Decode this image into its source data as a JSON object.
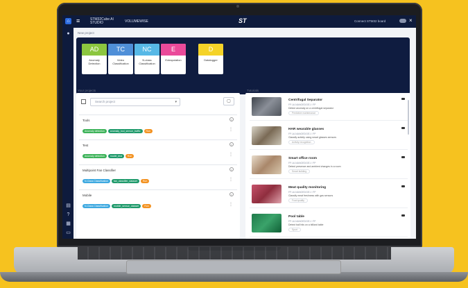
{
  "brand": {
    "line1": "STM32Cube AI",
    "line2": "STUDIO",
    "partner": "VOLUMEWISE",
    "logo": "ST",
    "right_text": "Connect STM32 board"
  },
  "sidebar": {
    "icons": [
      "home-icon",
      "user-icon",
      "file-icon",
      "help-icon",
      "doc-icon",
      "folder-icon"
    ]
  },
  "new_project": {
    "title": "New project"
  },
  "tiles": [
    {
      "abbr": "AD",
      "label": "Anomaly Detection",
      "color": "#8cc63f"
    },
    {
      "abbr": "TC",
      "label": "Video Classification",
      "color": "#4f8fd8"
    },
    {
      "abbr": "NC",
      "label": "N-class Classification",
      "color": "#57b8e6"
    },
    {
      "abbr": "E",
      "label": "Extrapolation",
      "color": "#ea4a9a"
    },
    {
      "abbr": "D",
      "label": "Datalogger",
      "color": "#f5d328"
    }
  ],
  "projects_panel": {
    "title": "Your projects",
    "search_placeholder": "Search project"
  },
  "projects": [
    {
      "name": "Tools",
      "chips": [
        {
          "text": "Anomaly detection",
          "color": "#3eb35a"
        },
        {
          "text": "anomaly_tool_sensor_traffic",
          "color": "#1f9a6b"
        },
        {
          "text": "Run",
          "color": "#f39221"
        }
      ]
    },
    {
      "name": "Test",
      "chips": [
        {
          "text": "Anomaly detection",
          "color": "#3eb35a"
        },
        {
          "text": "model_test",
          "color": "#1f9a6b"
        },
        {
          "text": "Run",
          "color": "#f39221"
        }
      ]
    },
    {
      "name": "Multipoint Fan Classifier",
      "chips": [
        {
          "text": "N-Class Classification",
          "color": "#3ea9e0"
        },
        {
          "text": "fan_classifier_dataset",
          "color": "#1f9a6b"
        },
        {
          "text": "Run",
          "color": "#f39221"
        }
      ]
    },
    {
      "name": "Mobile",
      "chips": [
        {
          "text": "N-Class Classification",
          "color": "#3ea9e0"
        },
        {
          "text": "mobile_sensor_dataset",
          "color": "#1f9a6b"
        },
        {
          "text": "Run",
          "color": "#f39221"
        }
      ]
    }
  ],
  "tutorials_panel": {
    "title": "Tutorials"
  },
  "tutorials": [
    {
      "title": "Centrifugal Separator",
      "sub": "FP-AI-NANOEDGE1 / FP",
      "desc": "Detect anomaly on a centrifugal separator",
      "pill": "Predictive maintenance",
      "thumb": "#6b6f77"
    },
    {
      "title": "HAR wearable glasses",
      "sub": "FP-AI-NANOEDGE1 / FP",
      "desc": "Classify activity using smart glasses sensors",
      "pill": "Activity recognition",
      "thumb": "#8b7d6b"
    },
    {
      "title": "Smart office room",
      "sub": "FP-AI-NANOEDGE1 / FP",
      "desc": "Detect presence and ambient changes in a room",
      "pill": "Smart building",
      "thumb": "#b49a7c"
    },
    {
      "title": "Meat quality monitoring",
      "sub": "FP-AI-NANOEDGE1 / FP",
      "desc": "Classify meat freshness with gas sensors",
      "pill": "Food quality",
      "thumb": "#b0485a"
    },
    {
      "title": "Pool table",
      "sub": "FP-AI-NANOEDGE1 / FP",
      "desc": "Detect ball hits on a billiard table",
      "pill": "Sport",
      "thumb": "#2e8b57"
    }
  ]
}
